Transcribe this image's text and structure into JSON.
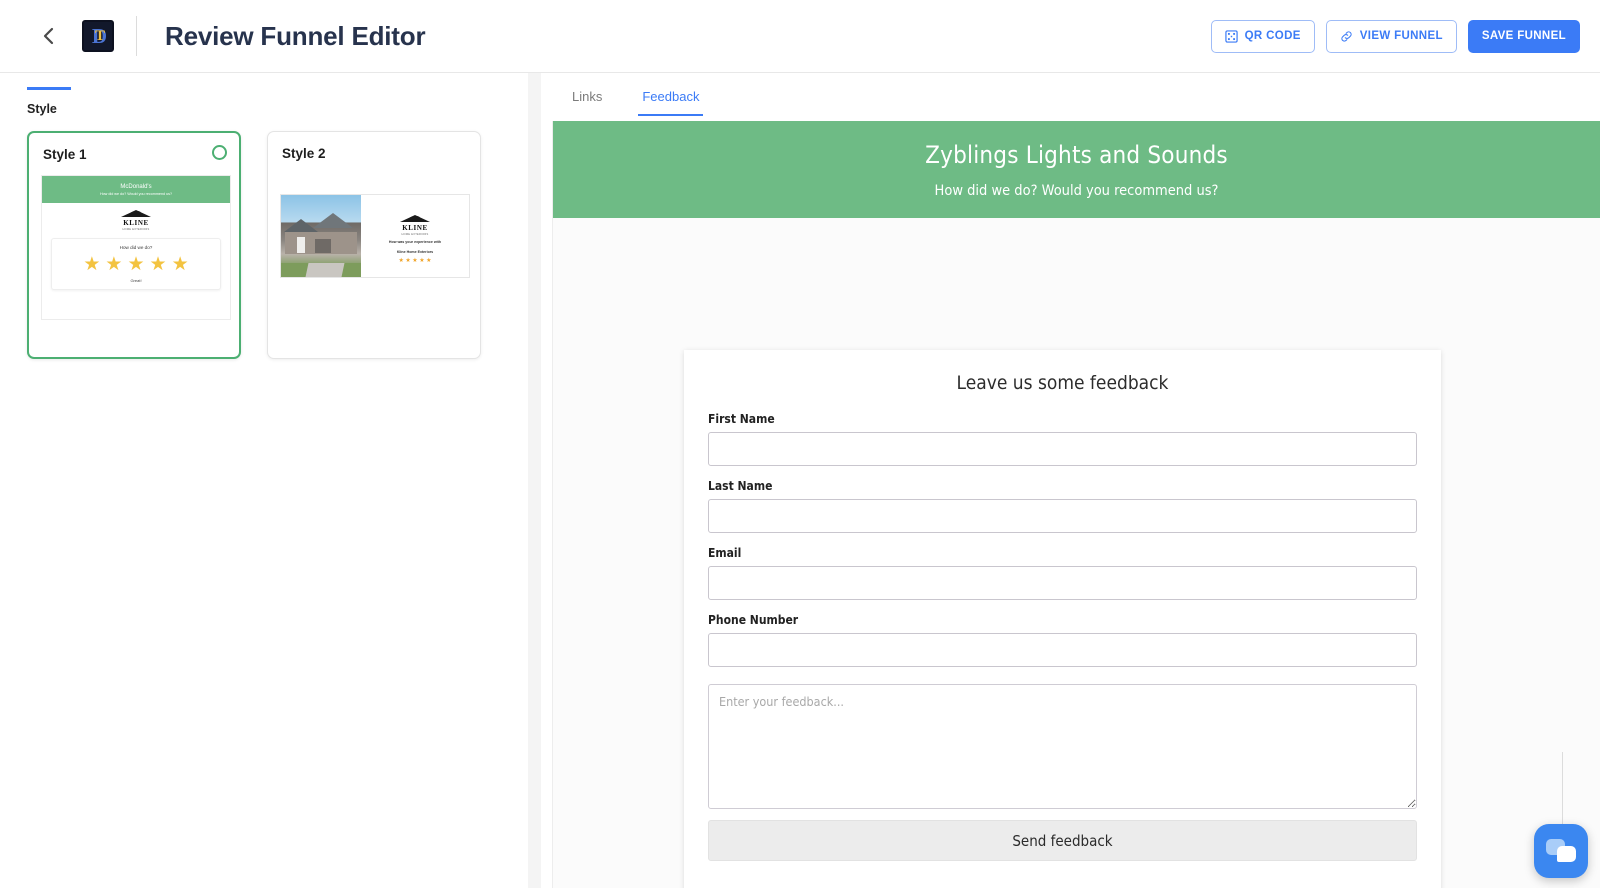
{
  "header": {
    "back_icon": "chevron-left-icon",
    "logo_letter_primary": "D",
    "logo_letter_accent": "T",
    "title": "Review Funnel Editor",
    "actions": [
      {
        "label": "QR CODE",
        "icon": "qr-code-icon",
        "style": "outline"
      },
      {
        "label": "VIEW FUNNEL",
        "icon": "link-icon",
        "style": "outline"
      },
      {
        "label": "SAVE FUNNEL",
        "icon": "",
        "style": "primary"
      }
    ]
  },
  "sidebar": {
    "section_label": "Style",
    "styles": [
      {
        "title": "Style 1",
        "selected": true,
        "preview": {
          "banner_title": "McDonald's",
          "banner_subtitle": "How did we do? Would you recommend us?",
          "logo_word": "KLINE",
          "logo_tagline": "HOME EXTERIORS",
          "question": "How did we do?",
          "stars": 5,
          "rating_caption": "Great!"
        }
      },
      {
        "title": "Style 2",
        "selected": false,
        "preview": {
          "logo_word": "KLINE",
          "logo_tagline": "HOME EXTERIORS",
          "question_line1": "How was your experience with",
          "question_line2": "Kline Home Exteriors",
          "stars": 5
        }
      }
    ]
  },
  "main": {
    "tabs": [
      {
        "label": "Links",
        "active": false
      },
      {
        "label": "Feedback",
        "active": true
      }
    ],
    "preview": {
      "banner_title": "Zyblings Lights and Sounds",
      "banner_subtitle": "How did we do? Would you recommend us?",
      "form": {
        "heading": "Leave us some feedback",
        "fields": [
          {
            "label": "First Name",
            "value": "",
            "name": "first-name"
          },
          {
            "label": "Last Name",
            "value": "",
            "name": "last-name"
          },
          {
            "label": "Email",
            "value": "",
            "name": "email"
          },
          {
            "label": "Phone Number",
            "value": "",
            "name": "phone-number"
          }
        ],
        "textarea_placeholder": "Enter your feedback...",
        "textarea_value": "",
        "submit_label": "Send feedback"
      }
    }
  },
  "chat": {
    "icon": "chat-bubbles-icon"
  },
  "colors": {
    "accent_blue": "#3b7bf6",
    "banner_green": "#6ebb85",
    "selected_green": "#4caf72",
    "star_yellow": "#f3c340",
    "star_orange": "#f0a429"
  }
}
